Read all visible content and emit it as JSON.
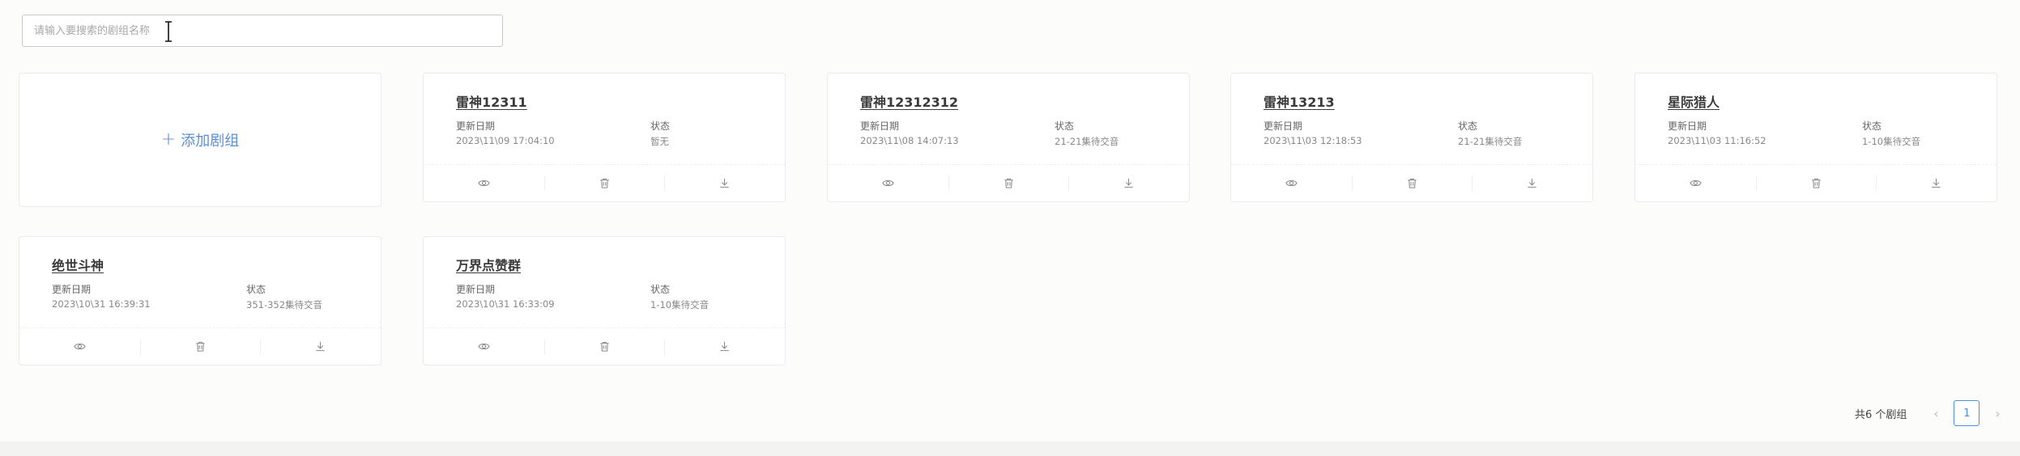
{
  "search": {
    "placeholder": "请输入要搜索的剧组名称"
  },
  "add_card": {
    "label": "添加剧组"
  },
  "labels": {
    "updated": "更新日期",
    "status": "状态"
  },
  "cards": [
    {
      "title": "雷神12311",
      "date": "2023\\11\\09 17:04:10",
      "status": "暂无"
    },
    {
      "title": "雷神12312312",
      "date": "2023\\11\\08 14:07:13",
      "status": "21-21集待交音"
    },
    {
      "title": "雷神13213",
      "date": "2023\\11\\03 12:18:53",
      "status": "21-21集待交音"
    },
    {
      "title": "星际猎人",
      "date": "2023\\11\\03 11:16:52",
      "status": "1-10集待交音"
    },
    {
      "title": "绝世斗神",
      "date": "2023\\10\\31 16:39:31",
      "status": "351-352集待交音"
    },
    {
      "title": "万界点赞群",
      "date": "2023\\10\\31 16:33:09",
      "status": "1-10集待交音"
    }
  ],
  "pagination": {
    "total_text": "共6 个剧组",
    "current_page": "1",
    "prev": "‹",
    "next": "›"
  },
  "icons": {
    "view": "eye-icon",
    "delete": "trash-icon",
    "download": "download-icon"
  },
  "colors": {
    "accent": "#4a90e2",
    "add_text": "#5b8fd6"
  }
}
